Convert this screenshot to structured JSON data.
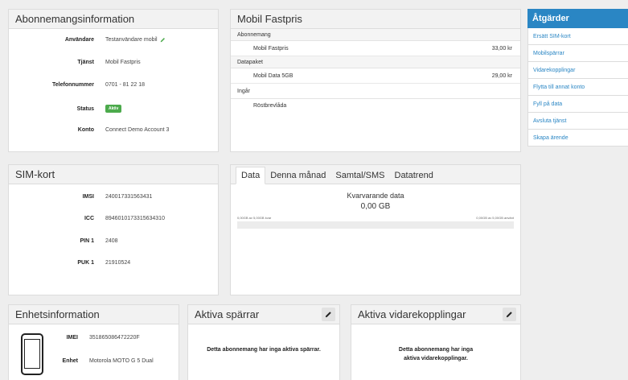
{
  "subscription_info": {
    "title": "Abonnemangsinformation",
    "rows": [
      {
        "label": "Användare",
        "value": "Testanvändare mobil"
      },
      {
        "label": "Tjänst",
        "value": "Mobil Fastpris"
      },
      {
        "label": "Telefonnummer",
        "value": "0701 - 81 22 18"
      },
      {
        "label": "Status",
        "value": "Aktiv"
      },
      {
        "label": "Konto",
        "value": "Connect Demo Account 3"
      }
    ]
  },
  "fixed_price": {
    "title": "Mobil Fastpris",
    "subscription_label": "Abonnemang",
    "subscription_item": {
      "name": "Mobil Fastpris",
      "price": "33,00 kr"
    },
    "datapackage_label": "Datapaket",
    "datapackage_item": {
      "name": "Mobil Data 5GB",
      "price": "29,00 kr"
    },
    "included_label": "Ingår",
    "included_item": "Röstbrevlåda"
  },
  "actions": {
    "title": "Åtgärder",
    "items": [
      "Ersätt SIM-kort",
      "Mobilspärrar",
      "Vidarekopplingar",
      "Flytta till annat konto",
      "Fyll på data",
      "Avsluta tjänst",
      "Skapa ärende"
    ]
  },
  "sim_card": {
    "title": "SIM-kort",
    "rows": [
      {
        "label": "IMSI",
        "value": "240017331563431"
      },
      {
        "label": "ICC",
        "value": "8946010173315634310"
      },
      {
        "label": "PIN 1",
        "value": "2408"
      },
      {
        "label": "PUK 1",
        "value": "21910524"
      }
    ]
  },
  "data_panel": {
    "tabs": [
      "Data",
      "Denna månad",
      "Samtal/SMS",
      "Datatrend"
    ],
    "remaining_label": "Kvarvarande data",
    "remaining_value": "0,00 GB",
    "left_caption": "0,00GB av 5,00GB kvar",
    "right_caption": "0,00GB av 5,00GB använt",
    "used_fraction": 0
  },
  "device_info": {
    "title": "Enhetsinformation",
    "rows": [
      {
        "label": "IMEI",
        "value": "351865086472220F"
      },
      {
        "label": "Enhet",
        "value": "Motorola MOTO G 5 Dual"
      }
    ]
  },
  "active_blocks": {
    "title": "Aktiva spärrar",
    "message": "Detta abonnemang har inga aktiva spärrar."
  },
  "active_forwards": {
    "title": "Aktiva vidarekopplingar",
    "message_line1": "Detta abonnemang har inga",
    "message_line2": "aktiva vidarekopplingar."
  }
}
